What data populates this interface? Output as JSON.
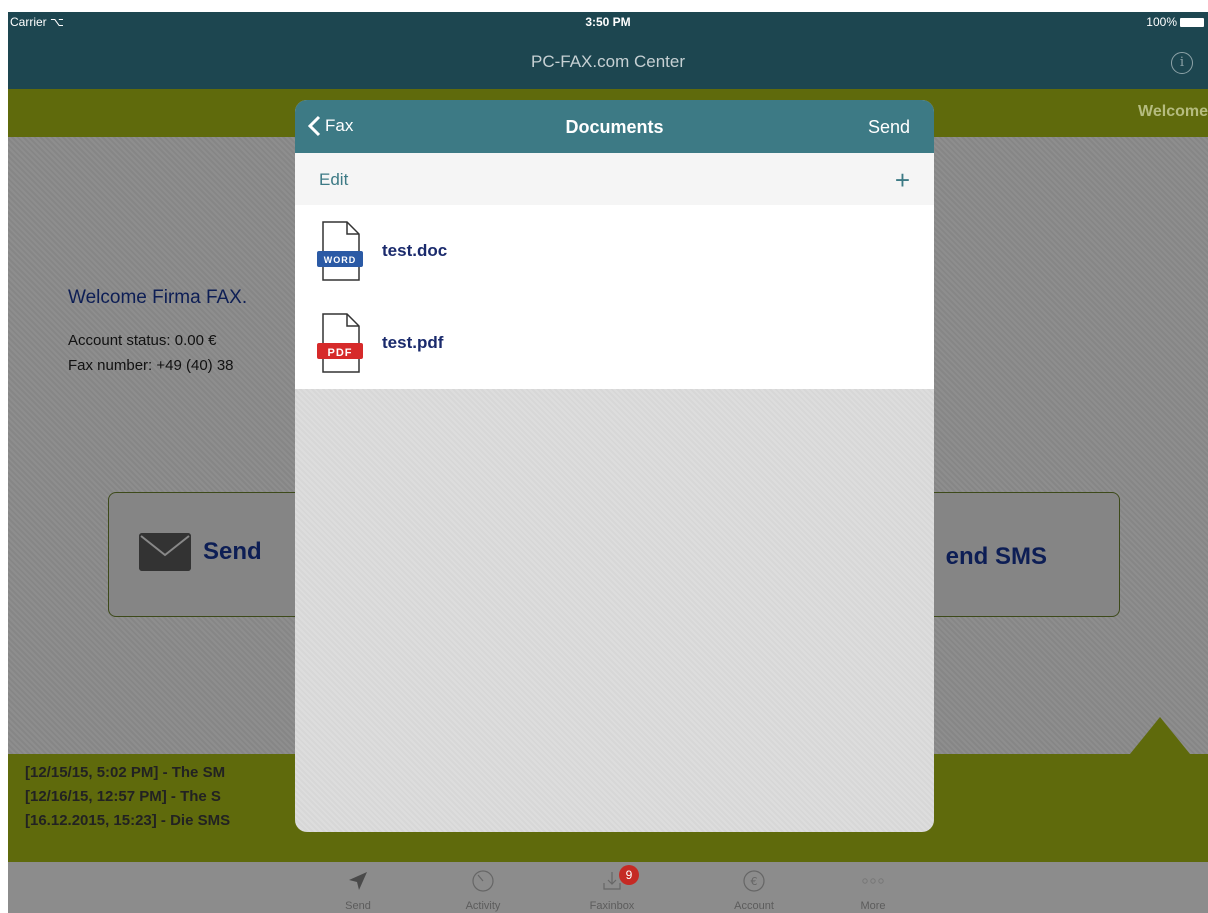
{
  "status_bar": {
    "carrier": "Carrier",
    "time": "3:50 PM",
    "battery": "100%"
  },
  "nav": {
    "title": "PC-FAX.com Center",
    "info_icon": "i"
  },
  "green_bar": {
    "welcome_tab": "Welcome"
  },
  "main": {
    "welcome": "Welcome Firma FAX.",
    "account_status": "Account status: 0.00 €",
    "fax_number": "Fax number: +49 (40) 38",
    "send_fax_label": "Send",
    "send_sms_label": "end SMS"
  },
  "ticker": {
    "lines": [
      "[12/15/15, 5:02 PM] - The SM",
      "[12/16/15, 12:57 PM] - The S",
      "[16.12.2015, 15:23] - Die SMS"
    ]
  },
  "tabbar": {
    "tabs": [
      {
        "label": "Send",
        "icon": "paper-plane-icon"
      },
      {
        "label": "Activity",
        "icon": "clock-icon"
      },
      {
        "label": "Faxinbox",
        "icon": "inbox-download-icon",
        "badge": "9"
      },
      {
        "label": "Account",
        "icon": "euro-icon"
      },
      {
        "label": "More",
        "icon": "more-dots-icon"
      }
    ]
  },
  "modal": {
    "back_label": "Fax",
    "title": "Documents",
    "send_label": "Send",
    "edit_label": "Edit",
    "add_label": "+",
    "documents": [
      {
        "name": "test.doc",
        "type_badge": "WORD",
        "badge_color": "#2b5aa5"
      },
      {
        "name": "test.pdf",
        "type_badge": "PDF",
        "badge_color": "#d62a2a"
      }
    ]
  }
}
